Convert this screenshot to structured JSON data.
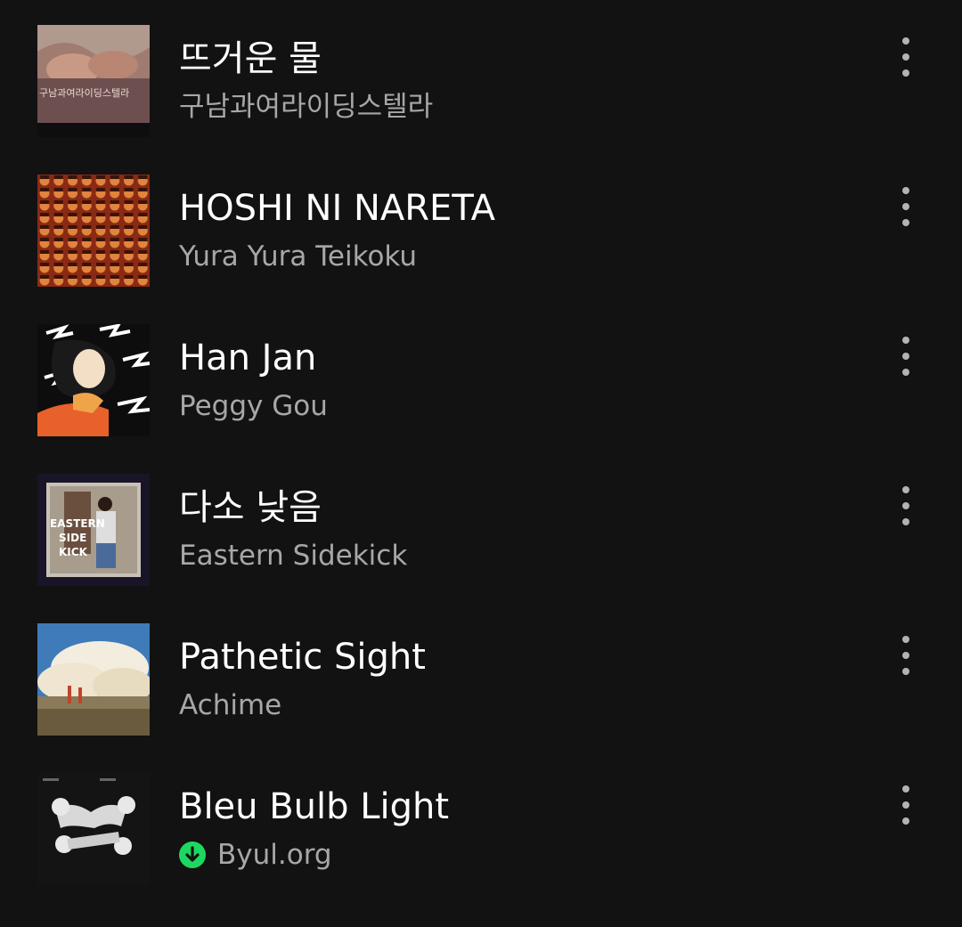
{
  "accent_color": "#1ed760",
  "tracks": [
    {
      "title": "뜨거운 물",
      "artist": "구남과여라이딩스텔라",
      "downloaded": false,
      "cover_text": "구남과여라이딩스텔라"
    },
    {
      "title": "HOSHI NI NARETA",
      "artist": "Yura Yura Teikoku",
      "downloaded": false
    },
    {
      "title": "Han Jan",
      "artist": "Peggy Gou",
      "downloaded": false
    },
    {
      "title": "다소 낮음",
      "artist": "Eastern Sidekick",
      "downloaded": false,
      "cover_text": [
        "EASTERN",
        "SIDE",
        "KICK"
      ]
    },
    {
      "title": "Pathetic Sight",
      "artist": "Achime",
      "downloaded": false
    },
    {
      "title": "Bleu Bulb Light",
      "artist": "Byul.org",
      "downloaded": true
    }
  ],
  "icons": {
    "more": "more-vertical-icon",
    "downloaded": "download-complete-icon"
  }
}
